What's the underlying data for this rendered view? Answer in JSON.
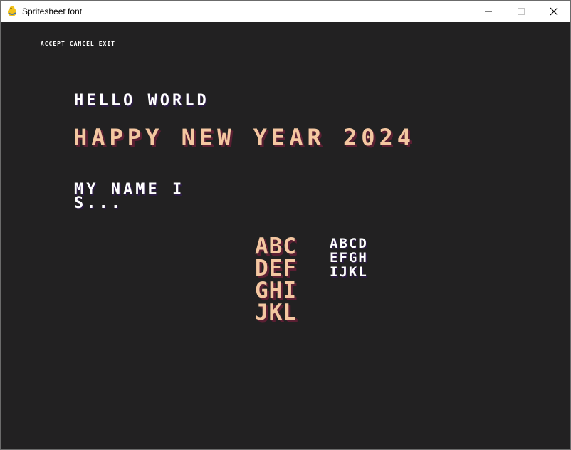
{
  "window": {
    "title": "Spritesheet font",
    "icon": "pygame-snake-icon",
    "controls": [
      "minimize-icon",
      "maximize-icon",
      "close-icon"
    ]
  },
  "menu": {
    "accept": "ACCEPT",
    "cancel": "CANCEL",
    "exit": "EXIT"
  },
  "texts": {
    "hello": "HELLO WORLD",
    "happy": "HAPPY NEW YEAR 2024",
    "my_name": "MY NAME I\nS..."
  },
  "grids": {
    "big": "ABC\nDEF\nGHI\nJKL",
    "small": "ABCD\nEFGH\nIJKL"
  },
  "colors": {
    "background": "#222122",
    "white_text": "#ffffff",
    "white_shadow": "#2b1b43",
    "peach_text": "#f4c7a1",
    "peach_shadow": "#5a1f33"
  }
}
